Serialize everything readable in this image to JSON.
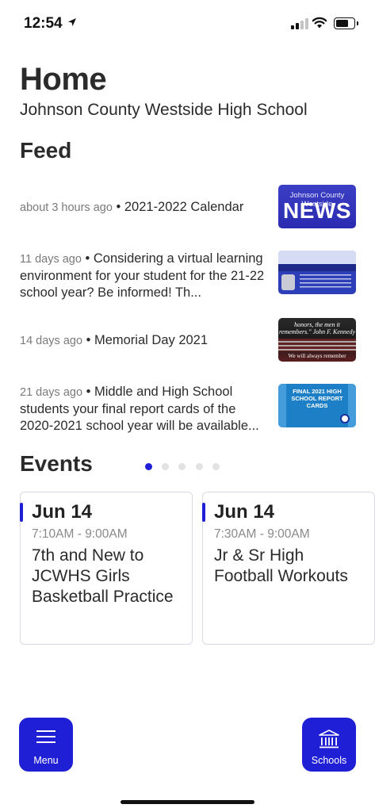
{
  "status_bar": {
    "time": "12:54"
  },
  "header": {
    "title": "Home",
    "school": "Johnson County Westside High School"
  },
  "feed": {
    "title": "Feed",
    "items": [
      {
        "time": "about 3 hours ago",
        "text": "2021-2022 Calendar",
        "thumb_line1": "Johnson County Westside",
        "thumb_line2": "NEWS"
      },
      {
        "time": "11 days ago",
        "text": "Considering a virtual learning environment for your student for the 21-22 school year? Be informed! Th..."
      },
      {
        "time": "14 days ago",
        "text": "Memorial Day 2021",
        "thumb_caption": "honors, the men it remembers.\" John F. Kennedy",
        "thumb_bottom": "We will always remember"
      },
      {
        "time": "21 days ago",
        "text": "Middle and High School students your final report cards of the 2020-2021 school year will be available...",
        "thumb_text": "FINAL 2021 HIGH SCHOOL REPORT CARDS"
      }
    ]
  },
  "events": {
    "title": "Events",
    "pager": {
      "count": 5,
      "active": 0
    },
    "items": [
      {
        "date": "Jun 14",
        "time": "7:10AM - 9:00AM",
        "name": "7th and New to JCWHS Girls Basketball Practice"
      },
      {
        "date": "Jun 14",
        "time": "7:30AM - 9:00AM",
        "name": "Jr & Sr High Football Workouts"
      }
    ]
  },
  "bottom_nav": {
    "menu_label": "Menu",
    "schools_label": "Schools"
  },
  "colors": {
    "accent": "#1f1fd6",
    "text": "#2b2b2b",
    "muted": "#7a7a7a"
  }
}
